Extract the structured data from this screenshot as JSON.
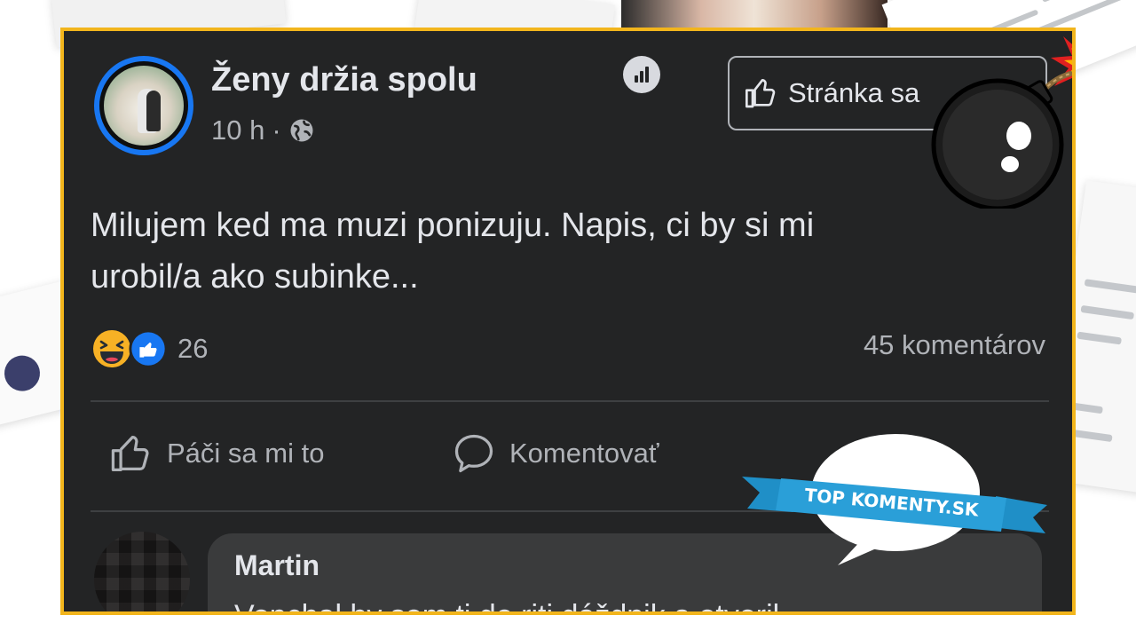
{
  "post": {
    "page_name": "Ženy držia spolu",
    "time": "10 h",
    "separator": "·",
    "follow_label": "Stránka sa",
    "text_line1": "Milujem ked ma muzi ponizuju. Napis, ci by si mi",
    "text_line2": "urobil/a ako subinke...",
    "reaction_count": "26",
    "comments_count": "45 komentárov",
    "actions": {
      "like": "Páči sa mi to",
      "comment": "Komentovať"
    },
    "comment": {
      "author": "Martin",
      "text": "Vopchal by som ti do riti dáždnik a otvoril"
    }
  },
  "stamp": {
    "text": "TOP KOMENTY.SK"
  },
  "icons": [
    "globe-icon",
    "stats-icon",
    "thumbs-up-icon",
    "bomb-icon",
    "haha-icon",
    "like-icon",
    "comment-icon"
  ],
  "colors": {
    "frame": "#f2b51c",
    "post_bg": "#232425",
    "accent_blue": "#1877f2",
    "text_primary": "#e4e6eb",
    "text_secondary": "#b0b3b8",
    "ribbon": "#2a9fd8"
  }
}
